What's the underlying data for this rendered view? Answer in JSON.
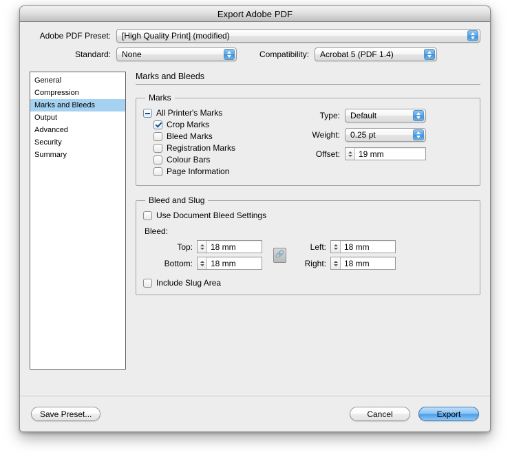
{
  "window": {
    "title": "Export Adobe PDF"
  },
  "top": {
    "preset_label": "Adobe PDF Preset:",
    "preset_value": "[High Quality Print] (modified)",
    "standard_label": "Standard:",
    "standard_value": "None",
    "compatibility_label": "Compatibility:",
    "compatibility_value": "Acrobat 5 (PDF 1.4)"
  },
  "sidebar": {
    "items": [
      {
        "label": "General",
        "selected": false
      },
      {
        "label": "Compression",
        "selected": false
      },
      {
        "label": "Marks and Bleeds",
        "selected": true
      },
      {
        "label": "Output",
        "selected": false
      },
      {
        "label": "Advanced",
        "selected": false
      },
      {
        "label": "Security",
        "selected": false
      },
      {
        "label": "Summary",
        "selected": false
      }
    ]
  },
  "pane": {
    "title": "Marks and Bleeds",
    "marks": {
      "legend": "Marks",
      "checkboxes": [
        {
          "label": "All Printer's Marks",
          "state": "mixed"
        },
        {
          "label": "Crop Marks",
          "state": "on"
        },
        {
          "label": "Bleed Marks",
          "state": "off"
        },
        {
          "label": "Registration Marks",
          "state": "off"
        },
        {
          "label": "Colour Bars",
          "state": "off"
        },
        {
          "label": "Page Information",
          "state": "off"
        }
      ],
      "type_label": "Type:",
      "type_value": "Default",
      "weight_label": "Weight:",
      "weight_value": "0.25 pt",
      "offset_label": "Offset:",
      "offset_value": "19 mm"
    },
    "bleed": {
      "legend": "Bleed and Slug",
      "use_document_label": "Use Document Bleed Settings",
      "use_document_state": "off",
      "bleed_label": "Bleed:",
      "top_label": "Top:",
      "top_value": "18 mm",
      "bottom_label": "Bottom:",
      "bottom_value": "18 mm",
      "left_label": "Left:",
      "left_value": "18 mm",
      "right_label": "Right:",
      "right_value": "18 mm",
      "link_icon": "link-icon",
      "include_slug_label": "Include Slug Area",
      "include_slug_state": "off"
    }
  },
  "footer": {
    "save_preset": "Save Preset...",
    "cancel": "Cancel",
    "export": "Export"
  },
  "colors": {
    "accent": "#4e9ee8",
    "selection": "#a6d2f2",
    "window_bg": "#ededed"
  }
}
